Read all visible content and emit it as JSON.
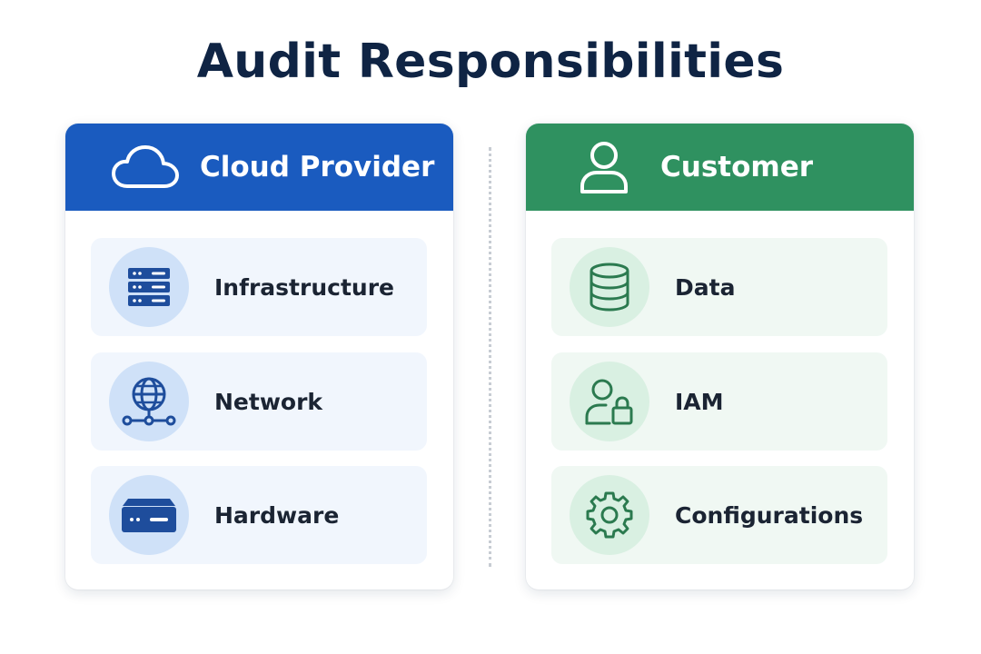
{
  "title": "Audit Responsibilities",
  "colors": {
    "provider_accent": "#1a5bbf",
    "customer_accent": "#2f9160",
    "provider_icon": "#1e4d9c",
    "customer_icon": "#2b7a4f",
    "title_text": "#0f2444"
  },
  "provider": {
    "header": "Cloud Provider",
    "header_icon": "cloud-icon",
    "items": [
      {
        "label": "Infrastructure",
        "icon": "server-rack-icon"
      },
      {
        "label": "Network",
        "icon": "network-globe-icon"
      },
      {
        "label": "Hardware",
        "icon": "hardware-device-icon"
      }
    ]
  },
  "customer": {
    "header": "Customer",
    "header_icon": "user-icon",
    "items": [
      {
        "label": "Data",
        "icon": "database-icon"
      },
      {
        "label": "IAM",
        "icon": "user-lock-icon"
      },
      {
        "label": "Configurations",
        "icon": "gear-icon"
      }
    ]
  }
}
